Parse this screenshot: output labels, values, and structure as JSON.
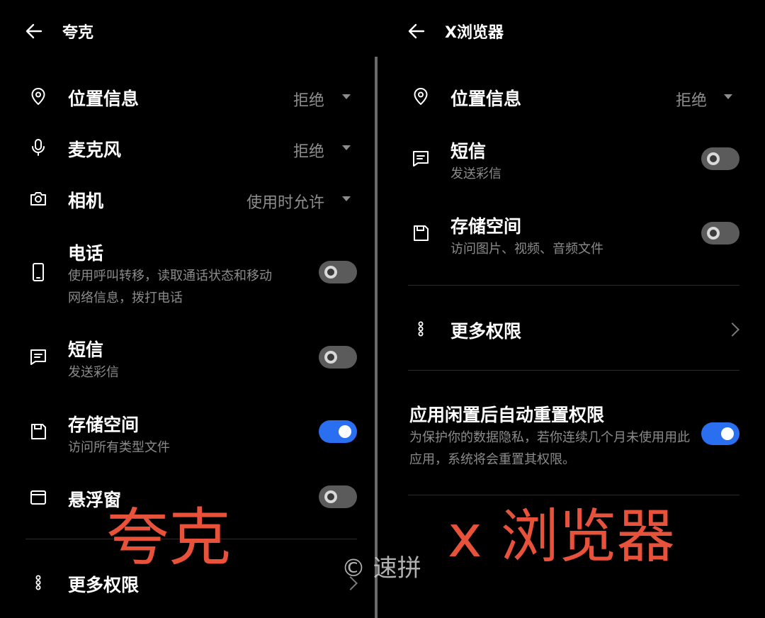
{
  "left": {
    "title": "夸克",
    "perms": [
      {
        "label": "位置信息",
        "value": "拒绝"
      },
      {
        "label": "麦克风",
        "value": "拒绝"
      },
      {
        "label": "相机",
        "value": "使用时允许"
      }
    ],
    "toggles": [
      {
        "label": "电话",
        "desc1": "使用呼叫转移，读取通话状态和移动",
        "desc2": "网络信息，拨打电话",
        "state": "off"
      },
      {
        "label": "短信",
        "desc1": "发送彩信",
        "state": "off"
      },
      {
        "label": "存储空间",
        "desc1": "访问所有类型文件",
        "state": "on"
      },
      {
        "label": "悬浮窗",
        "state": "off"
      }
    ],
    "more": "更多权限",
    "overlay_text": "夸克"
  },
  "right": {
    "title": "X浏览器",
    "perms": [
      {
        "label": "位置信息",
        "value": "拒绝"
      }
    ],
    "toggles": [
      {
        "label": "短信",
        "desc1": "发送彩信",
        "state": "off"
      },
      {
        "label": "存储空间",
        "desc1": "访问图片、视频、音频文件",
        "state": "off"
      }
    ],
    "more": "更多权限",
    "auto_reset": {
      "title": "应用闲置后自动重置权限",
      "desc": "为保护你的数据隐私，若你连续几个月未使用用此应用，系统将会重置其权限。",
      "state": "on"
    },
    "overlay_text": "x 浏览器"
  },
  "watermark": "© 速拼",
  "colors": {
    "toggle_on": "#2a6ff0",
    "overlay": "#e8523a"
  }
}
